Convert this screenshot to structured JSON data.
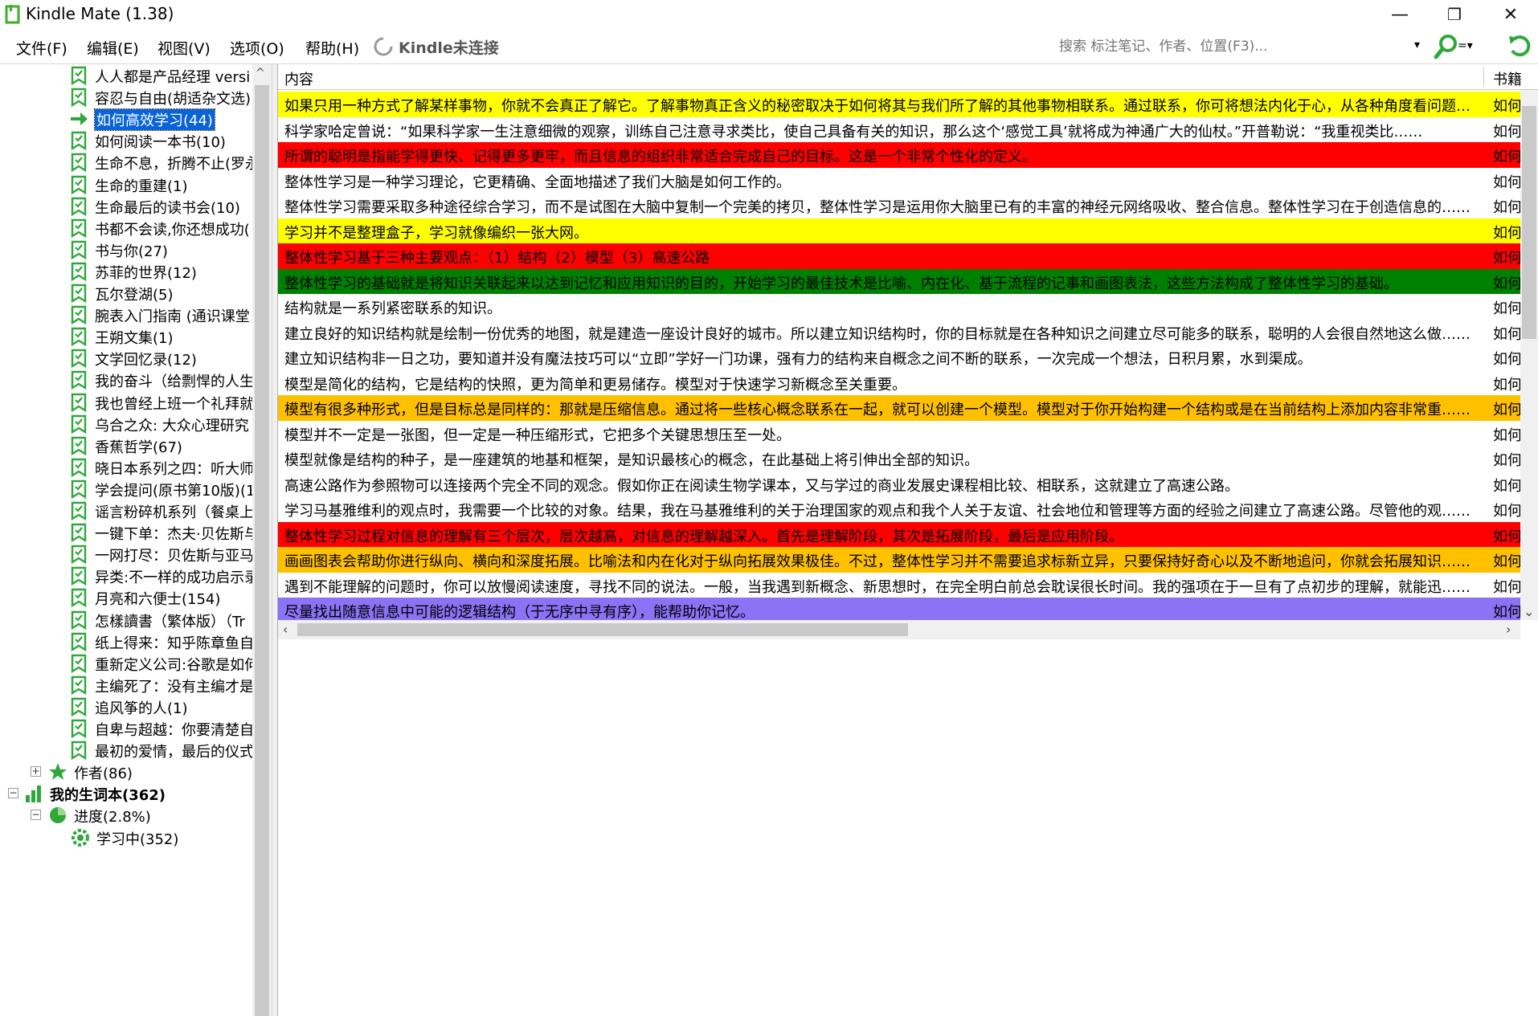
{
  "window": {
    "title": "Kindle Mate (1.38)",
    "minimize": "—",
    "maximize": "❐",
    "close": "✕"
  },
  "menu": {
    "file": "文件(F)",
    "edit": "编辑(E)",
    "view": "视图(V)",
    "options": "选项(O)",
    "help": "帮助(H)",
    "kindle_status": "Kindle未连接"
  },
  "search": {
    "placeholder": "搜索 标注笔记、作者、位置(F3)...",
    "dropdown": "▾",
    "options_glyph": "=▾"
  },
  "tree": {
    "books": [
      {
        "label": "人人都是产品经理 versi"
      },
      {
        "label": "容忍与自由(胡适杂文选)"
      },
      {
        "label": "如何高效学习(44)",
        "selected": true
      },
      {
        "label": "如何阅读一本书(10)"
      },
      {
        "label": "生命不息，折腾不止(罗永"
      },
      {
        "label": "生命的重建(1)"
      },
      {
        "label": "生命最后的读书会(10)"
      },
      {
        "label": "书都不会读,你还想成功("
      },
      {
        "label": "书与你(27)"
      },
      {
        "label": "苏菲的世界(12)"
      },
      {
        "label": "瓦尔登湖(5)"
      },
      {
        "label": "腕表入门指南 (通识课堂"
      },
      {
        "label": "王朔文集(1)"
      },
      {
        "label": "文学回忆录(12)"
      },
      {
        "label": "我的奋斗（给剽悍的人生"
      },
      {
        "label": "我也曾经上班一个礼拜就"
      },
      {
        "label": "乌合之众: 大众心理研究"
      },
      {
        "label": "香蕉哲学(67)"
      },
      {
        "label": "晓日本系列之四：听大师"
      },
      {
        "label": "学会提问(原书第10版)(1"
      },
      {
        "label": "谣言粉碎机系列（餐桌上"
      },
      {
        "label": "一键下单：杰夫·贝佐斯与"
      },
      {
        "label": "一网打尽：贝佐斯与亚马"
      },
      {
        "label": "异类:不一样的成功启示录"
      },
      {
        "label": "月亮和六便士(154)"
      },
      {
        "label": "怎樣讀書（繁体版）（Tr"
      },
      {
        "label": "纸上得来：知乎陈章鱼自"
      },
      {
        "label": "重新定义公司:谷歌是如何"
      },
      {
        "label": "主编死了：没有主编才是"
      },
      {
        "label": "追风筝的人(1)"
      },
      {
        "label": "自卑与超越：你要清楚自"
      },
      {
        "label": "最初的爱情，最后的仪式"
      }
    ],
    "authors": {
      "expander": "+",
      "label": "作者(86)"
    },
    "vocab": {
      "expander": "−",
      "label": "我的生词本(362)"
    },
    "progress": {
      "expander": "−",
      "label": "进度(2.8%)"
    },
    "learning": {
      "label": "学习中(352)"
    }
  },
  "grid": {
    "columns": {
      "content": "内容",
      "book": "书籍"
    },
    "rows": [
      {
        "content": "如果只用一种方式了解某样事物，你就不会真正了解它。了解事物真正含义的秘密取决于如何将其与我们所了解的其他事物相联系。通过联系，你可将想法内化于心，从各种角度看问题……",
        "book": "如何",
        "color": "#ffff00"
      },
      {
        "content": "科学家哈定曾说：“如果科学家一生注意细微的观察，训练自己注意寻求类比，使自己具备有关的知识，那么这个‘感觉工具’就将成为神通广大的仙杖。”开普勒说：“我重视类比……",
        "book": "如何",
        "color": "#ffffff"
      },
      {
        "content": "所谓的聪明是指能学得更快、记得更多更牢，而且信息的组织非常适合完成自己的目标。这是一个非常个性化的定义。",
        "book": "如何",
        "color": "#ff0000"
      },
      {
        "content": "整体性学习是一种学习理论，它更精确、全面地描述了我们大脑是如何工作的。",
        "book": "如何",
        "color": "#ffffff"
      },
      {
        "content": "整体性学习需要采取多种途径综合学习，而不是试图在大脑中复制一个完美的拷贝，整体性学习是运用你大脑里已有的丰富的神经元网络吸收、整合信息。整体性学习在于创造信息的……",
        "book": "如何",
        "color": "#ffffff"
      },
      {
        "content": "学习并不是整理盒子，学习就像编织一张大网。",
        "book": "如何",
        "color": "#ffff00"
      },
      {
        "content": "整体性学习基于三种主要观点：（1）结构（2）模型（3）高速公路",
        "book": "如何",
        "color": "#ff0000"
      },
      {
        "content": "整体性学习的基础就是将知识关联起来以达到记忆和应用知识的目的，开始学习的最佳技术是比喻、内在化、基于流程的记事和画图表法，这些方法构成了整体性学习的基础。",
        "book": "如何",
        "color": "#008000"
      },
      {
        "content": "结构就是一系列紧密联系的知识。",
        "book": "如何",
        "color": "#ffffff"
      },
      {
        "content": "建立良好的知识结构就是绘制一份优秀的地图，就是建造一座设计良好的城市。所以建立知识结构时，你的目标就是在各种知识之间建立尽可能多的联系，聪明的人会很自然地这么做……",
        "book": "如何",
        "color": "#ffffff"
      },
      {
        "content": "建立知识结构非一日之功，要知道并没有魔法技巧可以“立即”学好一门功课，强有力的结构来自概念之间不断的联系，一次完成一个想法，日积月累，水到渠成。",
        "book": "如何",
        "color": "#ffffff"
      },
      {
        "content": "模型是简化的结构，它是结构的快照，更为简单和更易储存。模型对于快速学习新概念至关重要。",
        "book": "如何",
        "color": "#ffffff"
      },
      {
        "content": "模型有很多种形式，但是目标总是同样的：那就是压缩信息。通过将一些核心概念联系在一起，就可以创建一个模型。模型对于你开始构建一个结构或是在当前结构上添加内容非常重……",
        "book": "如何",
        "color": "#ffc000"
      },
      {
        "content": "模型并不一定是一张图，但一定是一种压缩形式，它把多个关键思想压至一处。",
        "book": "如何",
        "color": "#ffffff"
      },
      {
        "content": "模型就像是结构的种子，是一座建筑的地基和框架，是知识最核心的概念，在此基础上将引伸出全部的知识。",
        "book": "如何",
        "color": "#ffffff"
      },
      {
        "content": "高速公路作为参照物可以连接两个完全不同的观念。假如你正在阅读生物学课本，又与学过的商业发展史课程相比较、相联系，这就建立了高速公路。",
        "book": "如何",
        "color": "#ffffff"
      },
      {
        "content": "学习马基雅维利的观点时，我需要一个比较的对象。结果，我在马基雅维利的关于治理国家的观点和我个人关于友谊、社会地位和管理等方面的经验之间建立了高速公路。尽管他的观……",
        "book": "如何",
        "color": "#ffffff"
      },
      {
        "content": "整体性学习过程对信息的理解有三个层次，层次越高，对信息的理解越深入。首先是理解阶段，其次是拓展阶段，最后是应用阶段。",
        "book": "如何",
        "color": "#ff0000"
      },
      {
        "content": "画画图表会帮助你进行纵向、横向和深度拓展。比喻法和内在化对于纵向拓展效果极佳。不过，整体性学习并不需要追求标新立异，只要保持好奇心以及不断地追问，你就会拓展知识……",
        "book": "如何",
        "color": "#ffc000"
      },
      {
        "content": "遇到不能理解的问题时，你可以放慢阅读速度，寻找不同的说法。一般，当我遇到新概念、新思想时，在完全明白前总会耽误很长时间。我的强项在于一旦有了点初步的理解，就能迅……",
        "book": "如何",
        "color": "#ffffff"
      },
      {
        "content": "尽量找出随意信息中可能的逻辑结构（于无序中寻有序），能帮助你记忆。",
        "book": "如何",
        "color": "#8a73f5"
      }
    ]
  },
  "icons": {
    "book": "book-icon",
    "arrow": "green-arrow-icon",
    "star": "star-icon",
    "bars": "bar-chart-icon",
    "pie": "pie-chart-icon",
    "gear": "gear-icon"
  }
}
